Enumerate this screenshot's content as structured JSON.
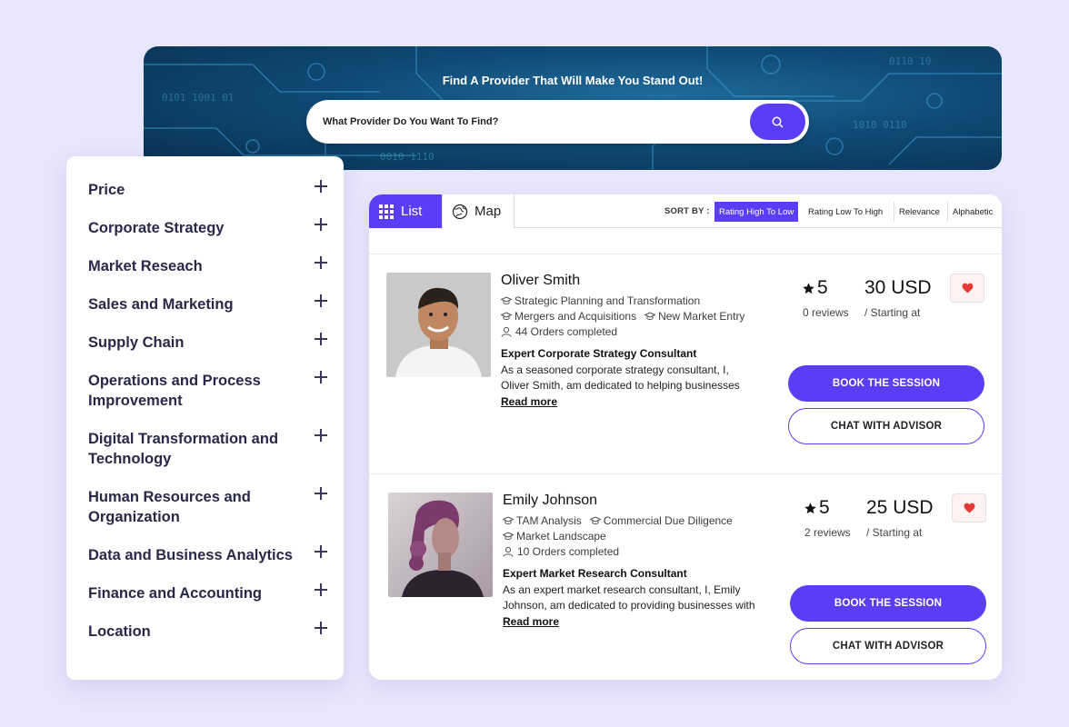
{
  "hero": {
    "title": "Find A Provider That Will Make You Stand Out!",
    "search_placeholder": "What Provider Do You Want To Find?"
  },
  "filters": [
    {
      "label": "Price"
    },
    {
      "label": "Corporate Strategy"
    },
    {
      "label": "Market Reseach"
    },
    {
      "label": "Sales and Marketing"
    },
    {
      "label": "Supply Chain"
    },
    {
      "label": "Operations and Process Improvement"
    },
    {
      "label": "Digital Transformation and Technology"
    },
    {
      "label": "Human Resources and Organization"
    },
    {
      "label": "Data and Business Analytics"
    },
    {
      "label": "Finance and Accounting"
    },
    {
      "label": "Location"
    }
  ],
  "toolbar": {
    "list_label": "List",
    "map_label": "Map",
    "sort_label": "SORT BY :",
    "sort_options": [
      "Rating High To Low",
      "Rating Low To High",
      "Relevance",
      "Alphabetic"
    ],
    "active_sort": "Rating High To Low"
  },
  "providers": [
    {
      "name": "Oliver Smith",
      "tags_line1": [
        "Strategic Planning and Transformation"
      ],
      "tags_line2": [
        "Mergers and Acquisitions",
        "New Market Entry"
      ],
      "orders": "44 Orders completed",
      "headline": "Expert Corporate Strategy Consultant",
      "desc_line1": "As a seasoned corporate strategy consultant, I,",
      "desc_line2": "Oliver Smith, am dedicated to helping businesses",
      "read_more": "Read more",
      "rating": "5",
      "reviews": "0 reviews",
      "price": "30 USD",
      "starting": "/ Starting at",
      "book_label": "BOOK THE SESSION",
      "chat_label": "CHAT WITH ADVISOR"
    },
    {
      "name": "Emily Johnson",
      "tags_line1": [
        "TAM Analysis",
        "Commercial Due Diligence"
      ],
      "tags_line2": [
        "Market Landscape"
      ],
      "orders": "10 Orders completed",
      "headline": "Expert Market Research Consultant",
      "desc_line1": "As an expert market research consultant, I, Emily",
      "desc_line2": "Johnson, am dedicated to providing businesses with",
      "read_more": "Read more",
      "rating": "5",
      "reviews": "2 reviews",
      "price": "25 USD",
      "starting": "/ Starting at",
      "book_label": "BOOK THE SESSION",
      "chat_label": "CHAT WITH ADVISOR"
    }
  ],
  "colors": {
    "accent": "#5a3df5",
    "background": "#e8e6fc",
    "heart": "#e53935"
  },
  "icons": [
    "search-icon",
    "grid-icon",
    "map-icon",
    "graduation-cap-icon",
    "user-icon",
    "star-icon",
    "heart-icon",
    "plus-icon"
  ]
}
